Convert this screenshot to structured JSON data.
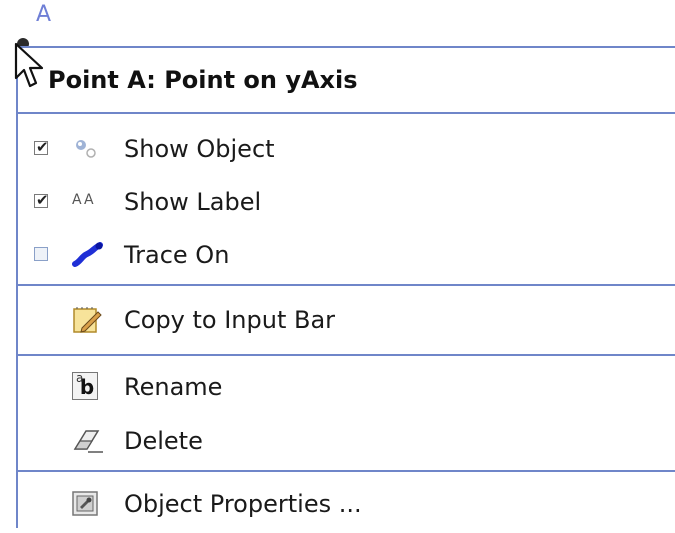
{
  "canvas": {
    "point_label": "A"
  },
  "menu": {
    "title": "Point A: Point on yAxis",
    "toggles": [
      {
        "label": "Show Object",
        "checked": true,
        "icon": "show-object-icon"
      },
      {
        "label": "Show Label",
        "checked": true,
        "icon": "label-aa-icon",
        "icon_text": "AA"
      },
      {
        "label": "Trace On",
        "checked": false,
        "icon": "trace-icon"
      }
    ],
    "copy_to_input_bar": {
      "label": "Copy to Input Bar",
      "icon": "notepad-pencil-icon"
    },
    "rename": {
      "label": "Rename",
      "icon": "rename-icon",
      "icon_sup": "a",
      "icon_main": "b"
    },
    "delete": {
      "label": "Delete",
      "icon": "eraser-icon"
    },
    "object_properties": {
      "label": "Object Properties ...",
      "icon": "properties-icon"
    }
  },
  "colors": {
    "menu_border": "#6f86c9",
    "point_label": "#6f7fd6",
    "trace_icon": "#1f2fd6"
  }
}
